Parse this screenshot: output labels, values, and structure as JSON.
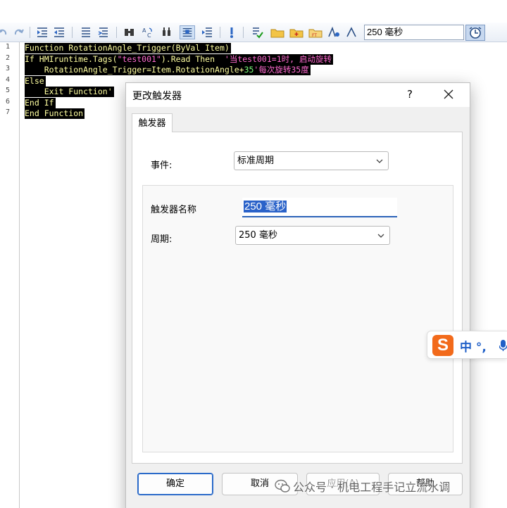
{
  "toolbar": {
    "trigger_period": "250 毫秒"
  },
  "editor": {
    "line_numbers": [
      "1",
      "2",
      "3",
      "4",
      "5",
      "6",
      "7"
    ],
    "lines": [
      [
        {
          "t": "kw",
          "v": "Function RotationAngle_Trigger(ByVal Item)"
        }
      ],
      [
        {
          "t": "kw",
          "v": "If HMIruntime.Tags("
        },
        {
          "t": "str",
          "v": "\"test001\""
        },
        {
          "t": "kw",
          "v": ").Read Then  "
        },
        {
          "t": "cmt",
          "v": "'当test001=1时, 启动旋转"
        }
      ],
      [
        {
          "t": "kw",
          "v": "    RotationAngle_Trigger=Item.RotationAngle+"
        },
        {
          "t": "num",
          "v": "35"
        },
        {
          "t": "cmt",
          "v": "'每次旋转35度"
        }
      ],
      [
        {
          "t": "kw",
          "v": "Else"
        }
      ],
      [
        {
          "t": "kw",
          "v": "    Exit Function'"
        }
      ],
      [
        {
          "t": "kw",
          "v": "End If"
        }
      ],
      [
        {
          "t": "kw",
          "v": "End Function"
        }
      ]
    ]
  },
  "dialog": {
    "title": "更改触发器",
    "help": "?",
    "tab": "触发器",
    "event_label": "事件:",
    "event_value": "标准周期",
    "name_label": "触发器名称",
    "name_value": "250 毫秒",
    "period_label": "周期:",
    "period_value": "250 毫秒",
    "ok": "确定",
    "cancel": "取消",
    "apply": "应用(A)",
    "help_button": "帮助"
  },
  "ime": {
    "logo": "S",
    "text": "中 °,"
  },
  "watermark": {
    "text": "公众号 · 机电工程手记立流水调"
  },
  "colors": {
    "editor_bg": "#000000",
    "keyword": "#ffffa0",
    "string": "#ff6ad0",
    "number": "#7cff7c",
    "accent": "#2a62c9",
    "ime_orange": "#f26a1b"
  }
}
